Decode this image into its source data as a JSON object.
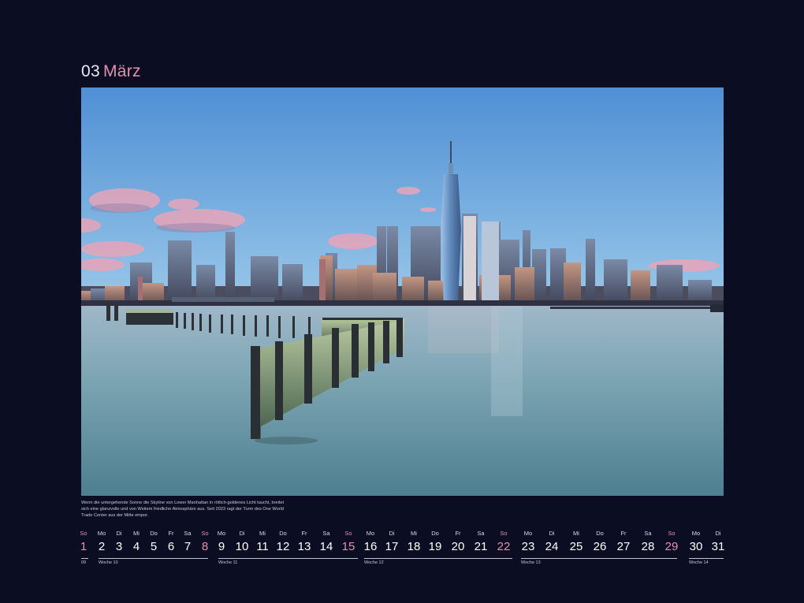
{
  "header": {
    "number": "03",
    "month": "März"
  },
  "photo": {
    "subject": "Lower Manhattan skyline at sunset with wooden pier posts in the Hudson River"
  },
  "caption": "Wenn die untergehende Sonne die Skyline von Lower Manhattan in rötlich-goldenes Licht taucht, breitet sich eine glanzvolle und von Weitem friedliche Atmosphäre aus. Seit 2023 ragt der Turm des One World Trade Center aus der Mitte empor.",
  "calendar": {
    "days": [
      {
        "name": "So",
        "date": "1",
        "sunday": true
      },
      {
        "name": "Mo",
        "date": "2"
      },
      {
        "name": "Di",
        "date": "3"
      },
      {
        "name": "Mi",
        "date": "4"
      },
      {
        "name": "Do",
        "date": "5"
      },
      {
        "name": "Fr",
        "date": "6"
      },
      {
        "name": "Sa",
        "date": "7"
      },
      {
        "name": "So",
        "date": "8",
        "sunday": true
      },
      {
        "name": "Mo",
        "date": "9"
      },
      {
        "name": "Di",
        "date": "10"
      },
      {
        "name": "Mi",
        "date": "11"
      },
      {
        "name": "Do",
        "date": "12"
      },
      {
        "name": "Fr",
        "date": "13"
      },
      {
        "name": "Sa",
        "date": "14"
      },
      {
        "name": "So",
        "date": "15",
        "sunday": true
      },
      {
        "name": "Mo",
        "date": "16"
      },
      {
        "name": "Di",
        "date": "17"
      },
      {
        "name": "Mi",
        "date": "18"
      },
      {
        "name": "Do",
        "date": "19"
      },
      {
        "name": "Fr",
        "date": "20"
      },
      {
        "name": "Sa",
        "date": "21"
      },
      {
        "name": "So",
        "date": "22",
        "sunday": true
      },
      {
        "name": "Mo",
        "date": "23"
      },
      {
        "name": "Di",
        "date": "24"
      },
      {
        "name": "Mi",
        "date": "25"
      },
      {
        "name": "Do",
        "date": "26"
      },
      {
        "name": "Fr",
        "date": "27"
      },
      {
        "name": "Sa",
        "date": "28"
      },
      {
        "name": "So",
        "date": "29",
        "sunday": true
      },
      {
        "name": "Mo",
        "date": "30"
      },
      {
        "name": "Di",
        "date": "31"
      }
    ],
    "weeks": [
      "09",
      "Woche 10",
      "Woche 11",
      "Woche 12",
      "Woche 13",
      "Woche 14"
    ]
  }
}
